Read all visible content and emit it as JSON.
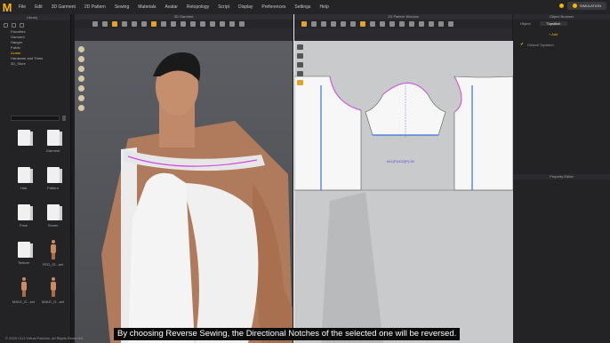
{
  "app": {
    "logo": "M",
    "menu": [
      "File",
      "Edit",
      "3D Garment",
      "2D Pattern",
      "Sewing",
      "Materials",
      "Avatar",
      "Retopology",
      "Script",
      "Display",
      "Preferences",
      "Settings",
      "Help"
    ],
    "mode_button": "SIMULATION"
  },
  "library": {
    "title": "Library",
    "tree": [
      "Favorites",
      "Garment",
      "Hanger",
      "Fabric",
      "Avatar",
      "Hardware and Trims",
      "3D_Store"
    ],
    "active_tree_index": 4,
    "items": [
      {
        "label": "..",
        "kind": "folder"
      },
      {
        "label": "Garment",
        "kind": "folder"
      },
      {
        "label": "Hair",
        "kind": "folder"
      },
      {
        "label": "Pattern",
        "kind": "folder"
      },
      {
        "label": "Pose",
        "kind": "folder"
      },
      {
        "label": "Shoes",
        "kind": "folder"
      },
      {
        "label": "Texture",
        "kind": "folder"
      },
      {
        "label": "FEO_Gl...avt",
        "kind": "avatar"
      },
      {
        "label": "MALE_G...avt",
        "kind": "avatar"
      },
      {
        "label": "MALE_O...avt",
        "kind": "avatar"
      }
    ]
  },
  "window3d": {
    "title": "3D Garment"
  },
  "window2d": {
    "title": "2D Pattern Window",
    "measurement": "641(P)/432(P):35"
  },
  "object_browser": {
    "title": "Object Browser",
    "tabs": [
      "Object",
      "Topstitch"
    ],
    "add_label": "+ Add",
    "item_label": "Default Topstitch"
  },
  "property_editor": {
    "title": "Property Editor"
  },
  "subtitle": "By choosing Reverse Sewing, the Directional Notches of the selected one will be reversed.",
  "copyright": "© 2020 CLO Virtual Fashion. All Rights Reserved.",
  "colors": {
    "accent": "#f5b700",
    "seam": "#3a6fd8",
    "highlight": "#d24be0"
  }
}
